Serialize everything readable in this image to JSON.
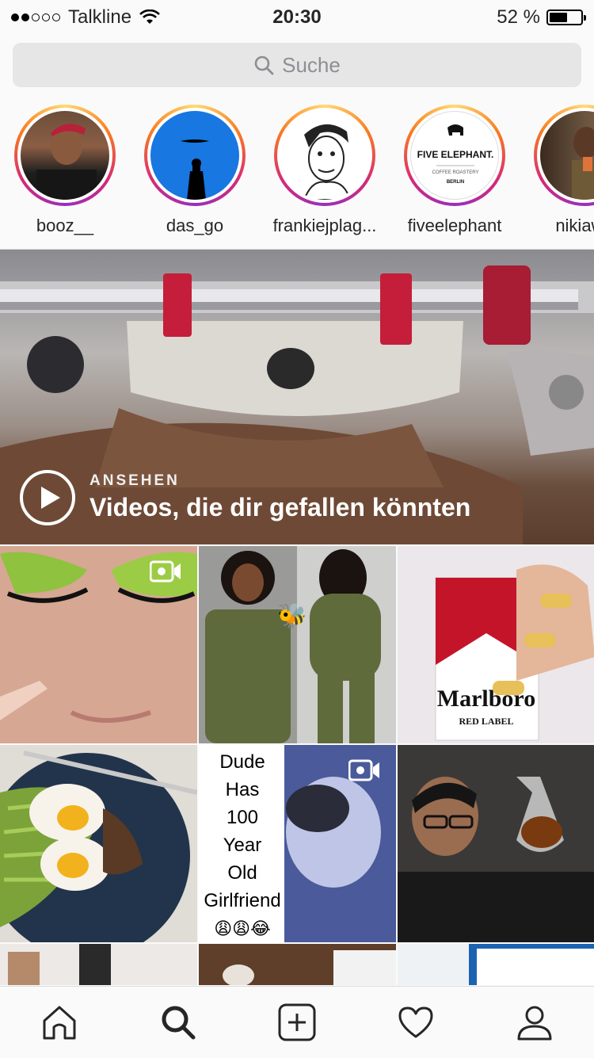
{
  "status_bar": {
    "carrier": "Talkline",
    "time": "20:30",
    "battery_text": "52 %",
    "battery_level": 0.52
  },
  "search": {
    "placeholder": "Suche",
    "icon": "search-icon"
  },
  "stories": [
    {
      "username": "booz__"
    },
    {
      "username": "das_go"
    },
    {
      "username": "frankiejplag..."
    },
    {
      "username": "fiveelephant",
      "logo_text": "FIVE ELEPHANT.",
      "logo_sub": "COFFEE ROASTERY",
      "logo_city": "BERLIN"
    },
    {
      "username": "nikiawa"
    }
  ],
  "video_banner": {
    "kicker": "ANSEHEN",
    "title": "Videos, die dir gefallen könnten",
    "icon": "play-icon"
  },
  "grid": {
    "posts": [
      {
        "subject": "makeup-eyes",
        "video": true
      },
      {
        "subject": "green-tracksuit",
        "video": false
      },
      {
        "subject": "cigarettes-nails",
        "video": false,
        "pack_label": "Marlboro",
        "pack_sub": "RED LABEL"
      },
      {
        "subject": "avocado-eggs",
        "video": false
      },
      {
        "subject": "meme-video",
        "video": true,
        "caption_lines": [
          "Dude",
          "Has",
          "100",
          "Year",
          "Old",
          "Girlfriend"
        ],
        "emoji": "😩😩😂"
      },
      {
        "subject": "coffee-chemex",
        "video": false
      }
    ]
  },
  "tab_bar": {
    "items": [
      "home-icon",
      "search-icon",
      "add-icon",
      "heart-icon",
      "profile-icon"
    ],
    "active": "search-icon"
  }
}
